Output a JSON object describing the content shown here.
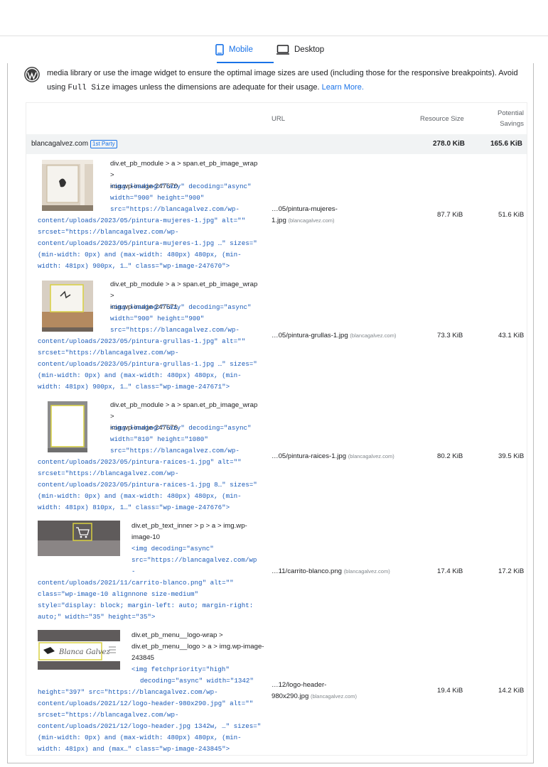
{
  "tabs": {
    "mobile": "Mobile",
    "desktop": "Desktop"
  },
  "description": {
    "line1": "media library or use the image widget to ensure the optimal image sizes are used (including those for the responsive breakpoints). Avoid",
    "line2_pre": "using ",
    "line2_code": "Full Size",
    "line2_post": " images unless the dimensions are adequate for their usage. ",
    "learn_more": "Learn More."
  },
  "table": {
    "headers": {
      "url": "URL",
      "resource_size": "Resource Size",
      "potential_line1": "Potential",
      "potential_line2": "Savings"
    },
    "group": {
      "name": "blancagalvez.com",
      "badge": "1st Party",
      "size": "278.0 KiB",
      "savings": "165.6 KiB"
    },
    "rows": [
      {
        "sel": [
          "div.et_pb_module > a > span.et_pb_image_wrap >",
          "img.wp-image-247670"
        ],
        "snip_indent": [
          "<img loading=\"lazy\" decoding=\"async\"",
          "width=\"900\" height=\"900\"",
          "src=\"https://blancagalvez.com/wp-"
        ],
        "snip_full": [
          "content/uploads/2023/05/pintura-mujeres-1.jpg\" alt=\"\"",
          "srcset=\"https://blancagalvez.com/wp-",
          "content/uploads/2023/05/pintura-mujeres-1.jpg …\" sizes=\"",
          "(min-width: 0px) and (max-width: 480px) 480px, (min-",
          "width: 481px) 900px, 1…\" class=\"wp-image-247670\">"
        ],
        "url": "…05/pintura-mujeres-",
        "url2": "1.jpg",
        "host": "(blancagalvez.com)",
        "size": "87.7 KiB",
        "savings": "51.6 KiB"
      },
      {
        "sel": [
          "div.et_pb_module > a > span.et_pb_image_wrap >",
          "img.wp-image-247671"
        ],
        "snip_indent": [
          "<img loading=\"lazy\" decoding=\"async\"",
          "width=\"900\" height=\"900\"",
          "src=\"https://blancagalvez.com/wp-"
        ],
        "snip_full": [
          "content/uploads/2023/05/pintura-grullas-1.jpg\" alt=\"\"",
          "srcset=\"https://blancagalvez.com/wp-",
          "content/uploads/2023/05/pintura-grullas-1.jpg …\" sizes=\"",
          "(min-width: 0px) and (max-width: 480px) 480px, (min-",
          "width: 481px) 900px, 1…\" class=\"wp-image-247671\">"
        ],
        "url": "…05/pintura-grullas-1.jpg",
        "url2": "",
        "host": "(blancagalvez.com)",
        "size": "73.3 KiB",
        "savings": "43.1 KiB"
      },
      {
        "sel": [
          "div.et_pb_module > a > span.et_pb_image_wrap >",
          "img.wp-image-247676"
        ],
        "snip_indent": [
          "<img loading=\"lazy\" decoding=\"async\"",
          "width=\"810\" height=\"1080\"",
          "src=\"https://blancagalvez.com/wp-"
        ],
        "snip_full": [
          "content/uploads/2023/05/pintura-raices-1.jpg\" alt=\"\"",
          "srcset=\"https://blancagalvez.com/wp-",
          "content/uploads/2023/05/pintura-raices-1.jpg 8…\" sizes=\"",
          "(min-width: 0px) and (max-width: 480px) 480px, (min-",
          "width: 481px) 810px, 1…\" class=\"wp-image-247676\">"
        ],
        "url": "…05/pintura-raices-1.jpg",
        "url2": "",
        "host": "(blancagalvez.com)",
        "size": "80.2 KiB",
        "savings": "39.5 KiB"
      },
      {
        "sel": [
          "div.et_pb_text_inner > p > a > img.wp-",
          "image-10"
        ],
        "snip_indent": [
          "<img decoding=\"async\"",
          "src=\"https://blancagalvez.com/wp",
          "-"
        ],
        "snip_full": [
          "content/uploads/2021/11/carrito-blanco.png\" alt=\"\"",
          "class=\"wp-image-10 alignnone size-medium\"",
          "style=\"display: block; margin-left: auto; margin-right:",
          "auto;\" width=\"35\" height=\"35\">"
        ],
        "url": "…11/carrito-blanco.png",
        "url2": "",
        "host": "(blancagalvez.com)",
        "size": "17.4 KiB",
        "savings": "17.2 KiB"
      },
      {
        "sel": [
          "div.et_pb_menu__logo-wrap >",
          "div.et_pb_menu__logo > a > img.wp-image-",
          "243845"
        ],
        "snip_indent": [
          "<img fetchpriority=\"high\"",
          "decoding=\"async\" width=\"1342\""
        ],
        "snip_full": [
          "height=\"397\" src=\"https://blancagalvez.com/wp-",
          "content/uploads/2021/12/logo-header-980x290.jpg\" alt=\"\"",
          "srcset=\"https://blancagalvez.com/wp-",
          "content/uploads/2021/12/logo-header.jpg 1342w, …\" sizes=\"",
          "(min-width: 0px) and (max-width: 480px) 480px, (min-",
          "width: 481px) and (max…\" class=\"wp-image-243845\">"
        ],
        "url": "…12/logo-header-",
        "url2": "980x290.jpg",
        "host": "(blancagalvez.com)",
        "size": "19.4 KiB",
        "savings": "14.2 KiB"
      }
    ]
  }
}
